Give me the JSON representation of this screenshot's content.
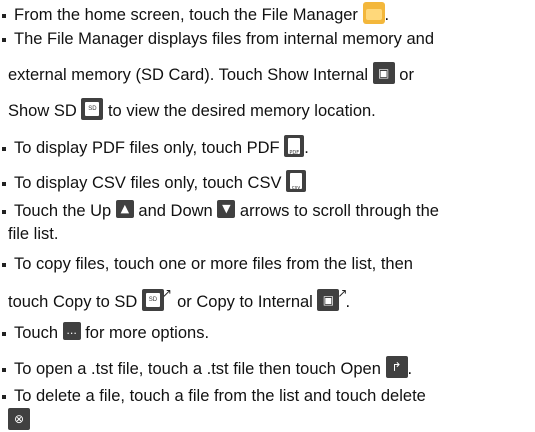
{
  "lines": [
    {
      "bullet": true,
      "a": "From the home screen, touch the File Manager",
      "b": "."
    },
    {
      "bullet": true,
      "a": "The File Manager displays files from internal memory and"
    },
    {
      "bullet": false,
      "a": "external memory (SD Card). Touch Show Internal",
      "b": "or"
    },
    {
      "bullet": false,
      "a": "Show SD",
      "b": "to view the desired memory location."
    },
    {
      "bullet": true,
      "a": "To display PDF files only, touch PDF",
      "b": "."
    },
    {
      "bullet": true,
      "a": "To display CSV files only, touch CSV"
    },
    {
      "bullet": true,
      "a": "Touch the Up",
      "b": "and Down",
      "c": "arrows to scroll through the"
    },
    {
      "bullet": false,
      "a": "file list."
    },
    {
      "bullet": true,
      "a": "To copy files, touch one or more files from the list, then"
    },
    {
      "bullet": false,
      "a": "touch Copy to SD",
      "b": "or Copy to Internal",
      "c": "."
    },
    {
      "bullet": true,
      "a": "Touch",
      "b": "for more options."
    },
    {
      "bullet": true,
      "a": "To open a .tst file, touch a .tst file then touch Open",
      "b": "."
    },
    {
      "bullet": true,
      "a": "To delete a file, touch a file from the list and touch delete"
    }
  ],
  "icons": {
    "pdf": "PDF",
    "csv": "csv",
    "sd": "SD",
    "more": "..."
  }
}
